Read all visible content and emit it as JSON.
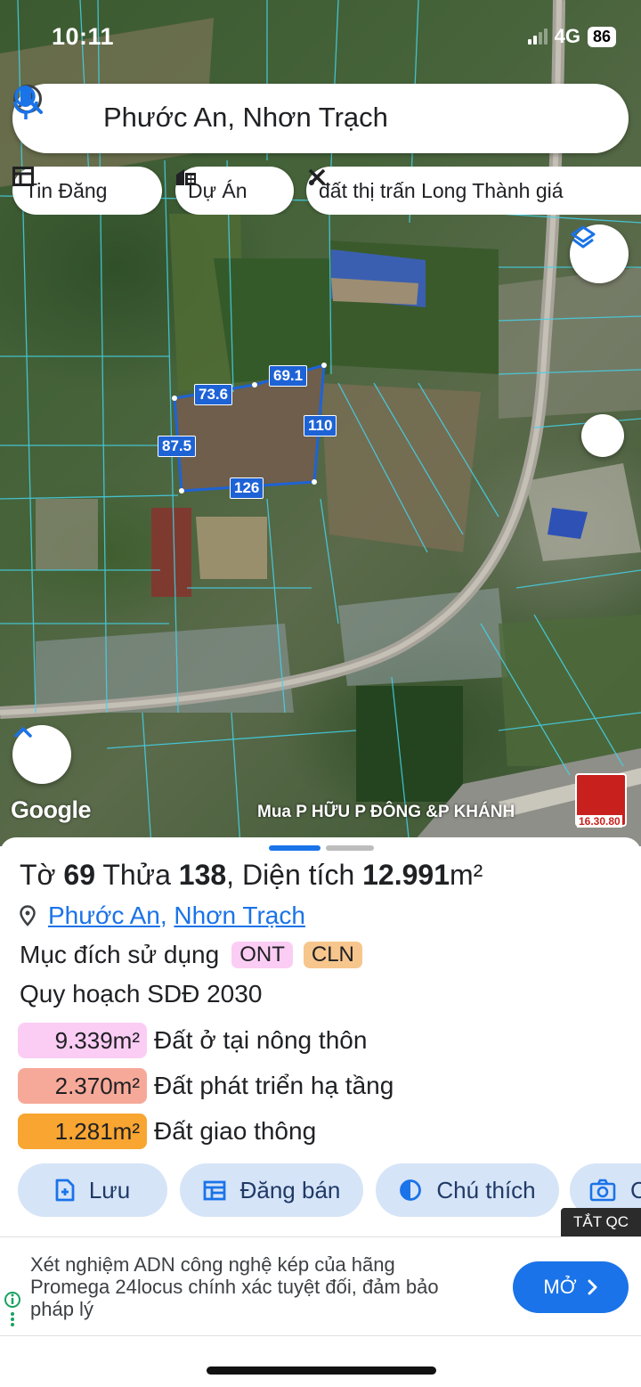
{
  "status_bar": {
    "time": "10:11",
    "network": "4G",
    "battery": "86"
  },
  "search": {
    "query": "Phước An, Nhơn Trạch"
  },
  "chips": [
    {
      "label": "Tin Đăng",
      "icon": "listing-icon"
    },
    {
      "label": "Dự Án",
      "icon": "building-icon"
    },
    {
      "label": "đất thị trấn Long Thành giá",
      "icon": "tools-icon"
    }
  ],
  "map": {
    "dimensions": [
      "69.1",
      "73.6",
      "110",
      "87.5",
      "126"
    ],
    "attribution": "Google",
    "caption": "Mua P HỮU P ĐÔNG &P KHÁNH",
    "ad_thumb_text": "16.30.80"
  },
  "parcel": {
    "sheet_prefix": "Tờ",
    "sheet_no": "69",
    "lot_prefix": "Thửa",
    "lot_no": "138",
    "area_prefix": ", Diện tích",
    "area": "12.991",
    "area_unit": "m²",
    "ward": "Phước An",
    "separator": ",",
    "district": "Nhơn Trạch",
    "purpose_label": "Mục đích sử dụng",
    "purpose_codes": [
      "ONT",
      "CLN"
    ],
    "plan_label": "Quy hoạch SDĐ 2030",
    "plan_rows": [
      {
        "area": "9.339m²",
        "label": "Đất ở tại nông thôn",
        "color": "#fbcdf4"
      },
      {
        "area": "2.370m²",
        "label": "Đất phát triển hạ tầng",
        "color": "#f7a999"
      },
      {
        "area": "1.281m²",
        "label": "Đất giao thông",
        "color": "#f8a531"
      }
    ]
  },
  "actions": [
    {
      "label": "Lưu",
      "icon": "add-document-icon"
    },
    {
      "label": "Đăng bán",
      "icon": "calendar-icon"
    },
    {
      "label": "Chú thích",
      "icon": "contrast-icon"
    },
    {
      "label": "C",
      "icon": "camera-icon"
    }
  ],
  "ads": {
    "hide_label": "TẮT QC",
    "text": "Xét nghiệm ADN công nghệ kép của hãng Promega 24locus chính xác tuyệt đối, đảm bảo pháp lý",
    "open_label": "MỞ"
  }
}
